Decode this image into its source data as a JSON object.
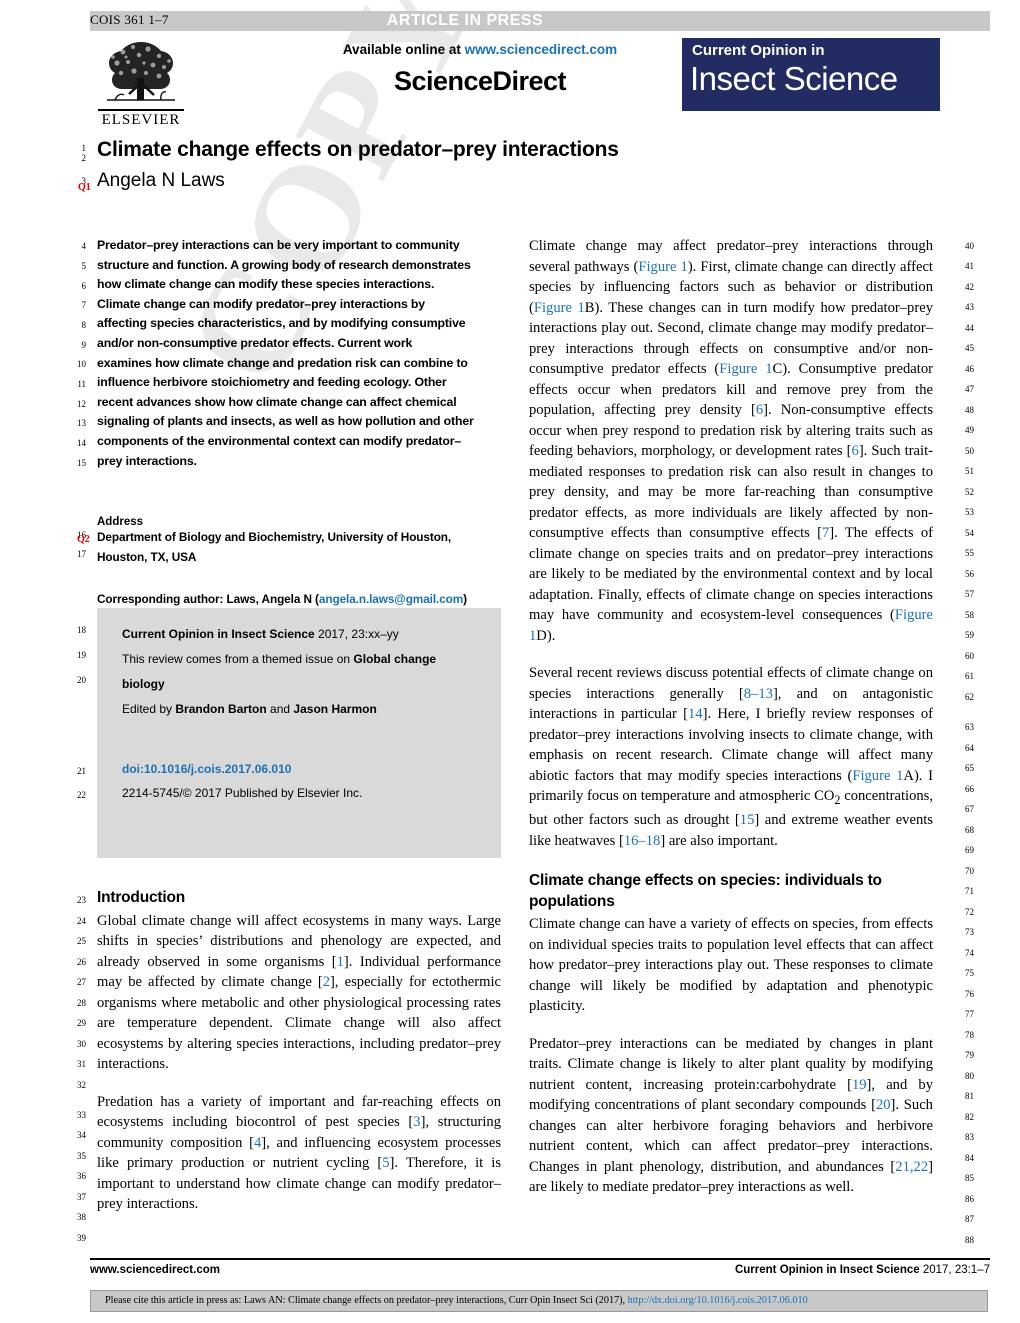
{
  "header": {
    "running_head": "COIS 361 1–7",
    "article_status": "ARTICLE IN PRESS",
    "available_online_prefix": "Available online at ",
    "available_online_url": "www.sciencedirect.com",
    "sciencedirect": "ScienceDirect",
    "journal_logo_line1": "Current Opinion in",
    "journal_logo_line2": "Insect Science",
    "publisher": "ELSEVIER"
  },
  "article": {
    "title": "Climate change effects on predator–prey interactions",
    "author": "Angela N Laws",
    "query_marker_1": "Q1",
    "query_marker_2": "Q2"
  },
  "abstract": {
    "lines": [
      "Predator–prey interactions can be very important to community",
      "structure and function. A growing body of research demonstrates",
      "how climate change can modify these species interactions.",
      "Climate change can modify predator–prey interactions by",
      "affecting species characteristics, and by modifying consumptive",
      "and/or non-consumptive predator effects. Current work",
      "examines how climate change and predation risk can combine to",
      "influence herbivore stoichiometry and feeding ecology. Other",
      "recent advances show how climate change can affect chemical",
      "signaling of plants and insects, as well as how pollution and other",
      "components of the environmental context can modify predator–",
      "prey interactions."
    ]
  },
  "address": {
    "heading": "Address",
    "lines": [
      "Department of Biology and Biochemistry, University of Houston,",
      "Houston, TX, USA"
    ],
    "corresponding_prefix": "Corresponding author: Laws, Angela N (",
    "corresponding_email": "angela.n.laws@gmail.com",
    "corresponding_suffix": ")"
  },
  "issue_box": {
    "journal_bold": "Current Opinion in Insect Science",
    "journal_rest": " 2017, 23:xx–yy",
    "themed_prefix": "This review comes from a themed issue on ",
    "themed_bold": "Global change biology",
    "edited_prefix": "Edited by ",
    "editor_one": "Brandon Barton",
    "edited_join": " and ",
    "editor_two": "Jason Harmon",
    "doi": "doi:10.1016/j.cois.2017.06.010",
    "copyright": "2214-5745/© 2017 Published by Elsevier Inc."
  },
  "left_column": {
    "intro_heading": "Introduction",
    "intro_paragraph_1_html": "Global climate change will affect ecosystems in many ways. Large shifts in species’ distributions and phenology are expected, and already observed in some organisms [<span class=\"c\">1</span>]. Individual performance may be affected by climate change [<span class=\"c\">2</span>], especially for ectothermic organisms where metabolic and other physiological processing rates are temperature dependent. Climate change will also affect ecosystems by altering species interactions, including predator–prey interactions.",
    "intro_paragraph_2_html": "Predation has a variety of important and far-reaching effects on ecosystems including biocontrol of pest species [<span class=\"c\">3</span>], structuring community composition [<span class=\"c\">4</span>], and influencing ecosystem processes like primary production or nutrient cycling [<span class=\"c\">5</span>]. Therefore, it is important to understand how climate change can modify predator–prey interactions."
  },
  "right_column": {
    "paragraph_1_html": "Climate change may affect predator–prey interactions through several pathways (<span class=\"c\">Figure 1</span>). First, climate change can directly affect species by influencing factors such as behavior or distribution (<span class=\"c\">Figure 1</span>B). These changes can in turn modify how predator–prey interactions play out. Second, climate change may modify predator–prey interactions through effects on consumptive and/or non-consumptive predator effects (<span class=\"c\">Figure 1</span>C). Consumptive predator effects occur when predators kill and remove prey from the population, affecting prey density [<span class=\"c\">6</span>]. Non-consumptive effects occur when prey respond to predation risk by altering traits such as feeding behaviors, morphology, or development rates [<span class=\"c\">6</span>]. Such trait-mediated responses to predation risk can also result in changes to prey density, and may be more far-reaching than consumptive predator effects, as more individuals are likely affected by non-consumptive effects than consumptive effects [<span class=\"c\">7</span>]. The effects of climate change on species traits and on predator–prey interactions are likely to be mediated by the environmental context and by local adaptation. Finally, effects of climate change on species interactions may have community and ecosystem-level consequences (<span class=\"c\">Figure 1</span>D).",
    "paragraph_2_html": "Several recent reviews discuss potential effects of climate change on species interactions generally [<span class=\"c\">8–13</span>], and on antagonistic interactions in particular [<span class=\"c\">14</span>]. Here, I briefly review responses of predator–prey interactions involving insects to climate change, with emphasis on recent research. Climate change will affect many abiotic factors that may modify species interactions (<span class=\"c\">Figure 1</span>A). I primarily focus on temperature and atmospheric CO<sub>2</sub> concentrations, but other factors such as drought [<span class=\"c\">15</span>] and extreme weather events like heatwaves [<span class=\"c\">16–18</span>] are also important.",
    "section_heading": "Climate change effects on species: individuals to populations",
    "paragraph_3_html": "Climate change can have a variety of effects on species, from effects on individual species traits to population level effects that can affect how predator–prey interactions play out. These responses to climate change will likely be modified by adaptation and phenotypic plasticity.",
    "paragraph_4_html": "Predator–prey interactions can be mediated by changes in plant traits. Climate change is likely to alter plant quality by modifying nutrient content, increasing protein:carbohydrate [<span class=\"c\">19</span>], and by modifying concentrations of plant secondary compounds [<span class=\"c\">20</span>]. Such changes can alter herbivore foraging behaviors and herbivore nutrient content, which can affect predator–prey interactions. Changes in plant phenology, distribution, and abundances [<span class=\"c\">21,22</span>] are likely to mediate predator–prey interactions as well."
  },
  "footer": {
    "left": "www.sciencedirect.com",
    "right_bold": "Current Opinion in Insect Science",
    "right_rest": " 2017, 23:1–7",
    "cite_prefix": "Please cite this article in press as: Laws AN: Climate change effects on predator–prey interactions, Curr Opin Insect Sci (2017), ",
    "cite_link": "http://dx.doi.org/10.1016/j.cois.2017.06.010"
  },
  "watermark": {
    "text": "COPY"
  },
  "colors": {
    "accent_blue": "#1a72b8",
    "journal_navy": "#222c63",
    "band_gray": "#c8c8c8",
    "box_gray": "#d9d9d9",
    "query_red": "#e00000"
  }
}
